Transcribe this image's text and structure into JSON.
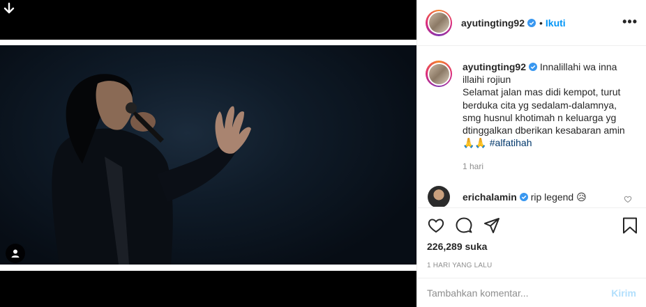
{
  "header": {
    "username": "ayutingting92",
    "separator": "•",
    "follow_label": "Ikuti",
    "more_label": "•••"
  },
  "caption": {
    "username": "ayutingting92",
    "text_line1": "Innalillahi wa inna illaihi rojiun",
    "text_line2": "Selamat jalan mas didi kempot, turut berduka cita yg sedalam-dalamnya, smg husnul khotimah n keluarga yg dtinggalkan dberikan kesabaran amin",
    "emoji": "🙏🙏",
    "hashtag": "#alfatihah",
    "time": "1 hari"
  },
  "comment": {
    "username": "erichalamin",
    "text": "rip legend",
    "emoji": "😥"
  },
  "actions": {
    "likes": "226,289 suka",
    "time_ago": "1 HARI YANG LALU"
  },
  "add_comment": {
    "placeholder": "Tambahkan komentar...",
    "post_label": "Kirim"
  },
  "colors": {
    "accent": "#0095f6",
    "post_disabled": "#b2dffc",
    "secondary_text": "#8e8e8e",
    "hashtag": "#00376b"
  },
  "icons": [
    "download-icon",
    "user-tag-icon",
    "verified-badge-icon",
    "more-options-icon",
    "heart-icon",
    "comment-icon",
    "share-icon",
    "bookmark-icon"
  ]
}
